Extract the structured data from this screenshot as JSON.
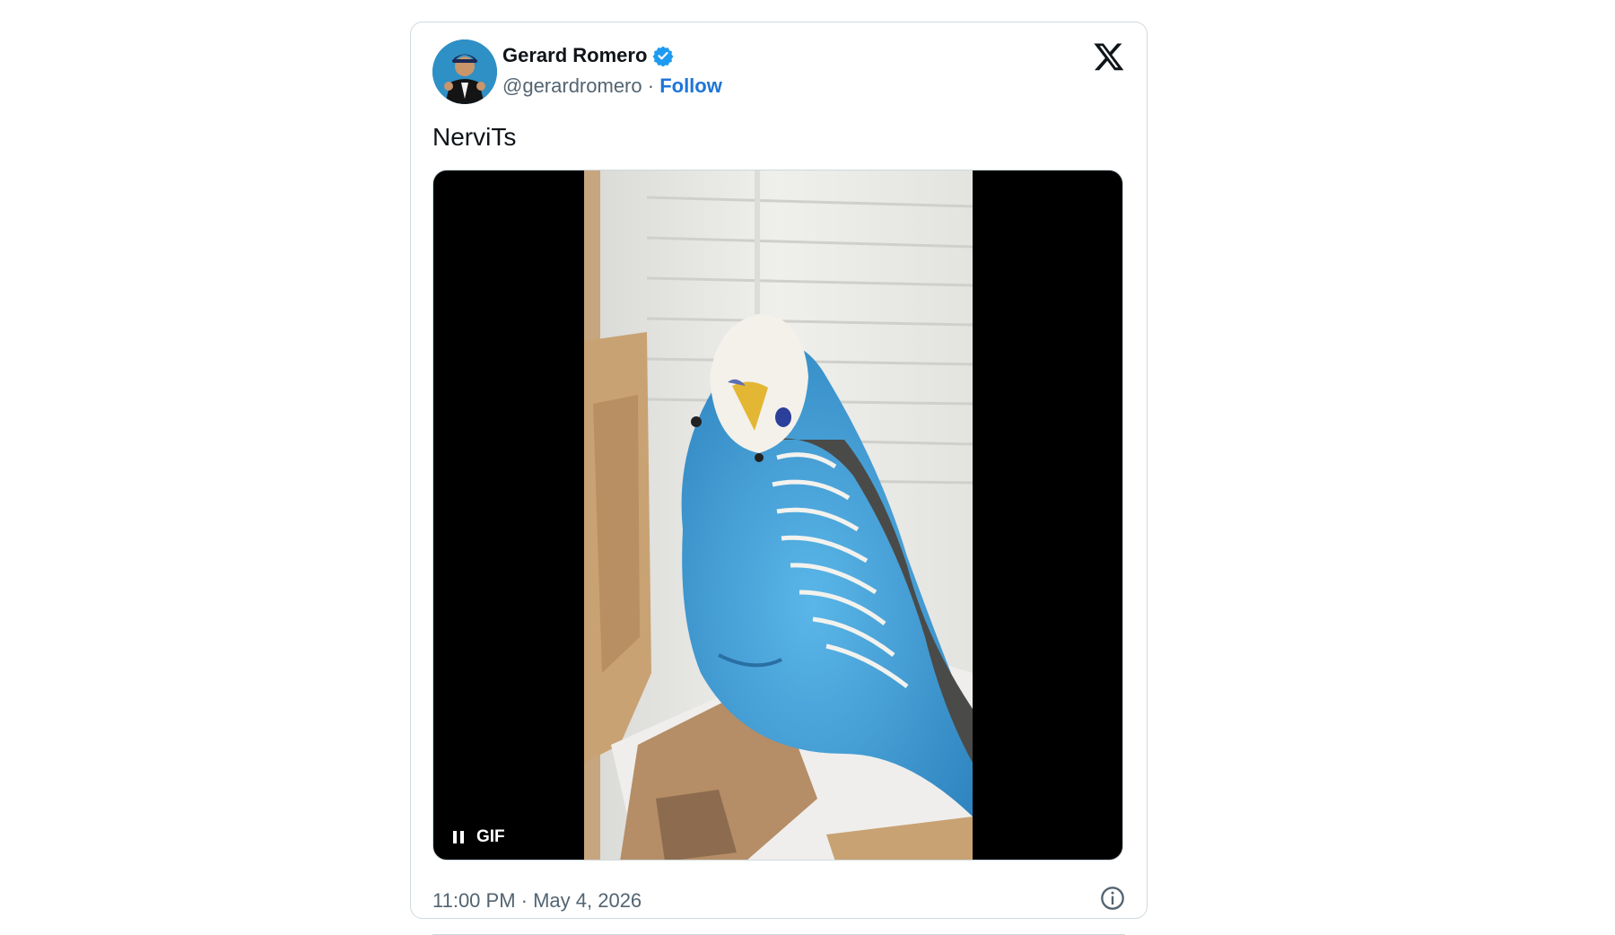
{
  "tweet": {
    "author_name": "Gerard Romero",
    "author_handle": "@gerardromero",
    "separator": " · ",
    "follow_label": "Follow",
    "text": "NerviTs",
    "media": {
      "type_label": "GIF",
      "state": "playing"
    },
    "timestamp": "11:00 PM · May 4, 2026"
  },
  "icons": {
    "verified": "verified-badge-icon",
    "brand": "x-logo-icon",
    "pause": "pause-icon",
    "info": "info-icon"
  },
  "colors": {
    "follow": "#1d75d8",
    "verified": "#1d9bf0",
    "muted_text": "#536471",
    "border": "#cfd9de"
  }
}
